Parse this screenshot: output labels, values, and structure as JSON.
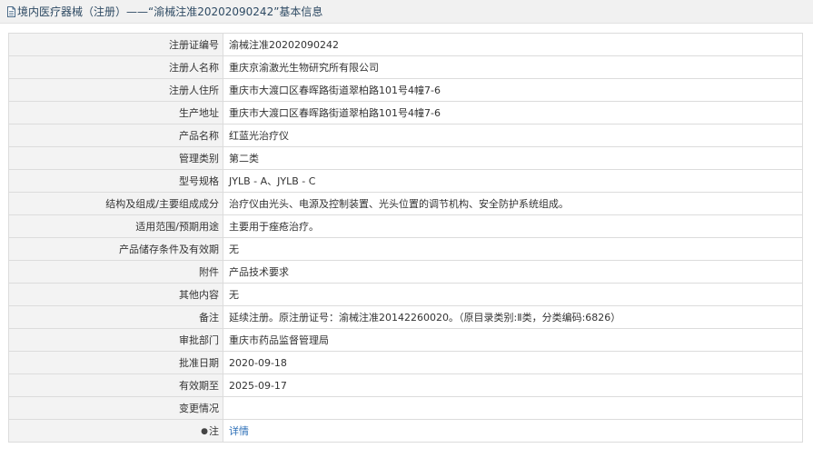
{
  "header": {
    "title": "境内医疗器械（注册）——“渝械注准20202090242”基本信息",
    "icon": "document-icon"
  },
  "rows": [
    {
      "label": "注册证编号",
      "value": "渝械注准20202090242"
    },
    {
      "label": "注册人名称",
      "value": "重庆京渝激光生物研究所有限公司"
    },
    {
      "label": "注册人住所",
      "value": "重庆市大渡口区春晖路街道翠柏路101号4幢7-6"
    },
    {
      "label": "生产地址",
      "value": "重庆市大渡口区春晖路街道翠柏路101号4幢7-6"
    },
    {
      "label": "产品名称",
      "value": "红蓝光治疗仪"
    },
    {
      "label": "管理类别",
      "value": "第二类"
    },
    {
      "label": "型号规格",
      "value": "JYLB - A、JYLB - C"
    },
    {
      "label": "结构及组成/主要组成成分",
      "value": "治疗仪由光头、电源及控制装置、光头位置的调节机构、安全防护系统组成。"
    },
    {
      "label": "适用范围/预期用途",
      "value": "主要用于痤疮治疗。"
    },
    {
      "label": "产品储存条件及有效期",
      "value": "无"
    },
    {
      "label": "附件",
      "value": "产品技术要求"
    },
    {
      "label": "其他内容",
      "value": "无"
    },
    {
      "label": "备注",
      "value": "延续注册。原注册证号：渝械注准20142260020。（原目录类别:Ⅱ类，分类编码:6826）"
    },
    {
      "label": "审批部门",
      "value": "重庆市药品监督管理局"
    },
    {
      "label": "批准日期",
      "value": "2020-09-18"
    },
    {
      "label": "有效期至",
      "value": "2025-09-17"
    },
    {
      "label": "变更情况",
      "value": ""
    }
  ],
  "note_row": {
    "bullet": "●",
    "label": "注",
    "link": "详情"
  }
}
